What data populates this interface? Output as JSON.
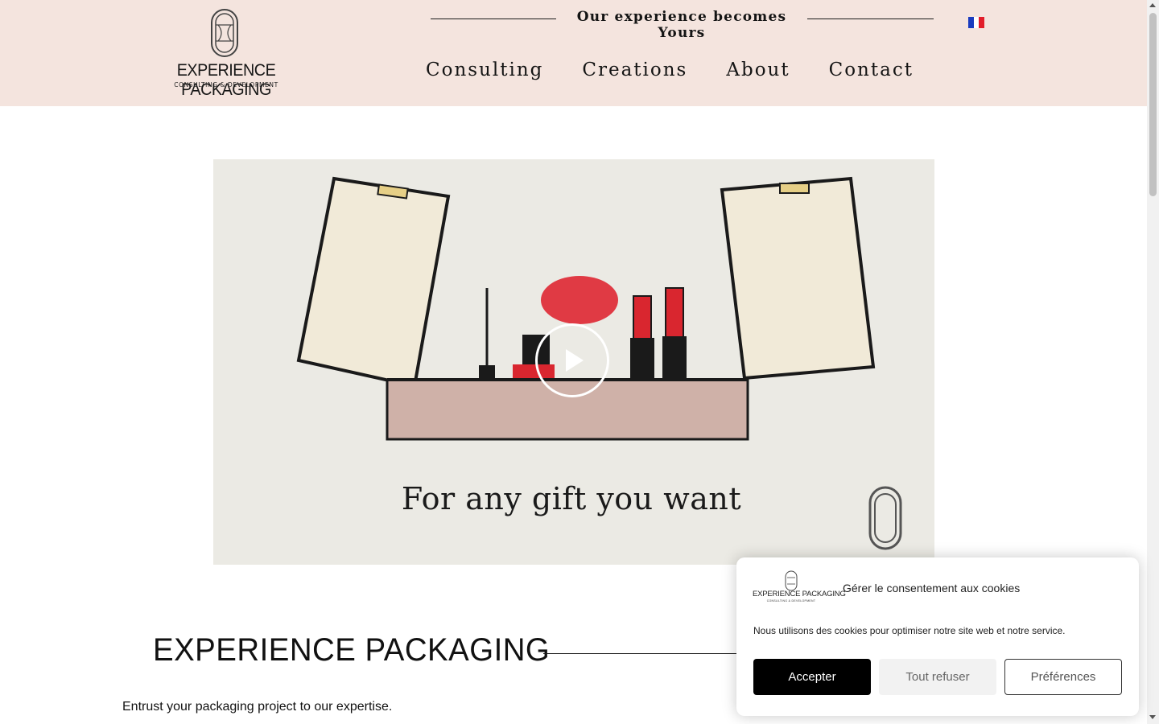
{
  "header": {
    "logo_name": "EXPERIENCE PACKAGING",
    "logo_subtitle": "CONSULTING & DEVELOPMENT",
    "tagline_start": "Our experience becomes ",
    "tagline_end": "Yours",
    "language_flag": "french-flag-icon",
    "nav": [
      "Consulting",
      "Creations",
      "About",
      "Contact"
    ]
  },
  "hero_video": {
    "caption": "For any gift you want",
    "play_icon": "play-icon"
  },
  "section": {
    "title": "EXPERIENCE PACKAGING",
    "intro": "Entrust your packaging project to our expertise."
  },
  "cookie_banner": {
    "logo_name": "EXPERIENCE PACKAGING",
    "logo_subtitle": "CONSULTING & DEVELOPMENT",
    "title": "Gérer le consentement aux cookies",
    "text": "Nous utilisons des cookies pour optimiser notre site web et notre service.",
    "accept": "Accepter",
    "refuse": "Tout refuser",
    "preferences": "Préférences"
  },
  "colors": {
    "header_bg": "#f4e4de",
    "accent_pink": "#c9a8a0",
    "lipstick_red": "#d9262f",
    "flag_blue": "#1a3cbf",
    "flag_red": "#e21d2a"
  }
}
